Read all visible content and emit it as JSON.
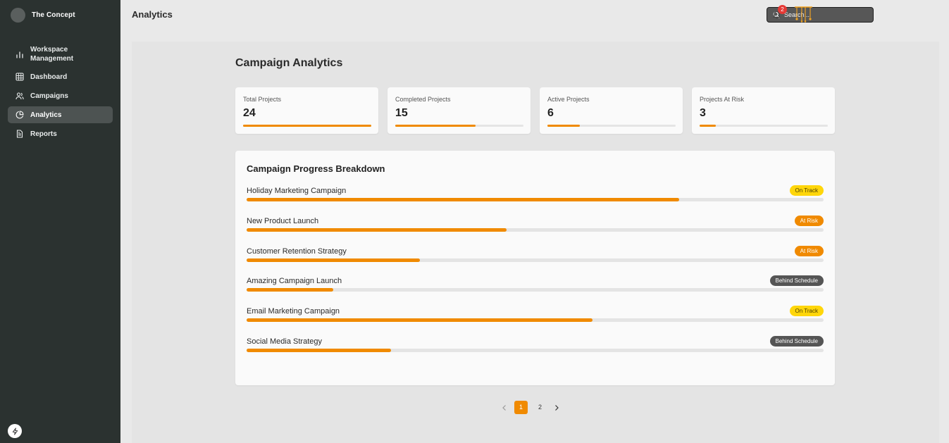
{
  "brand": {
    "name": "The Concept"
  },
  "sidebar": {
    "items": [
      {
        "label": "Workspace Management",
        "icon": "bar-chart-icon",
        "active": false
      },
      {
        "label": "Dashboard",
        "icon": "grid-icon",
        "active": false
      },
      {
        "label": "Campaigns",
        "icon": "users-icon",
        "active": false
      },
      {
        "label": "Analytics",
        "icon": "pie-chart-icon",
        "active": true
      },
      {
        "label": "Reports",
        "icon": "document-icon",
        "active": false
      }
    ]
  },
  "header": {
    "title": "Analytics",
    "search": {
      "placeholder": "Search..."
    },
    "notifications": {
      "count": "2",
      "icon": "bell-icon"
    },
    "logo_icon": "chandelier-logo-icon"
  },
  "main": {
    "title": "Campaign Analytics",
    "stats": [
      {
        "label": "Total Projects",
        "value": "24",
        "progress": 1.0
      },
      {
        "label": "Completed Projects",
        "value": "15",
        "progress": 0.625
      },
      {
        "label": "Active Projects",
        "value": "6",
        "progress": 0.25
      },
      {
        "label": "Projects At Risk",
        "value": "3",
        "progress": 0.125
      }
    ],
    "breakdown": {
      "title": "Campaign Progress Breakdown",
      "campaigns": [
        {
          "name": "Holiday Marketing Campaign",
          "status": "On Track",
          "status_type": "on-track",
          "progress": 0.75
        },
        {
          "name": "New Product Launch",
          "status": "At Risk",
          "status_type": "at-risk",
          "progress": 0.45
        },
        {
          "name": "Customer Retention Strategy",
          "status": "At Risk",
          "status_type": "at-risk",
          "progress": 0.3
        },
        {
          "name": "Amazing Campaign Launch",
          "status": "Behind Schedule",
          "status_type": "behind",
          "progress": 0.15
        },
        {
          "name": "Email Marketing Campaign",
          "status": "On Track",
          "status_type": "on-track",
          "progress": 0.6
        },
        {
          "name": "Social Media Strategy",
          "status": "Behind Schedule",
          "status_type": "behind",
          "progress": 0.25
        }
      ]
    },
    "pagination": {
      "pages": [
        "1",
        "2"
      ],
      "current": "1"
    }
  },
  "colors": {
    "sidebar_bg": "#2b3230",
    "accent": "#f08a00",
    "on_track": "#ffd60a",
    "at_risk": "#f08a00",
    "behind_schedule": "#555555",
    "notification_badge": "#e53935"
  }
}
